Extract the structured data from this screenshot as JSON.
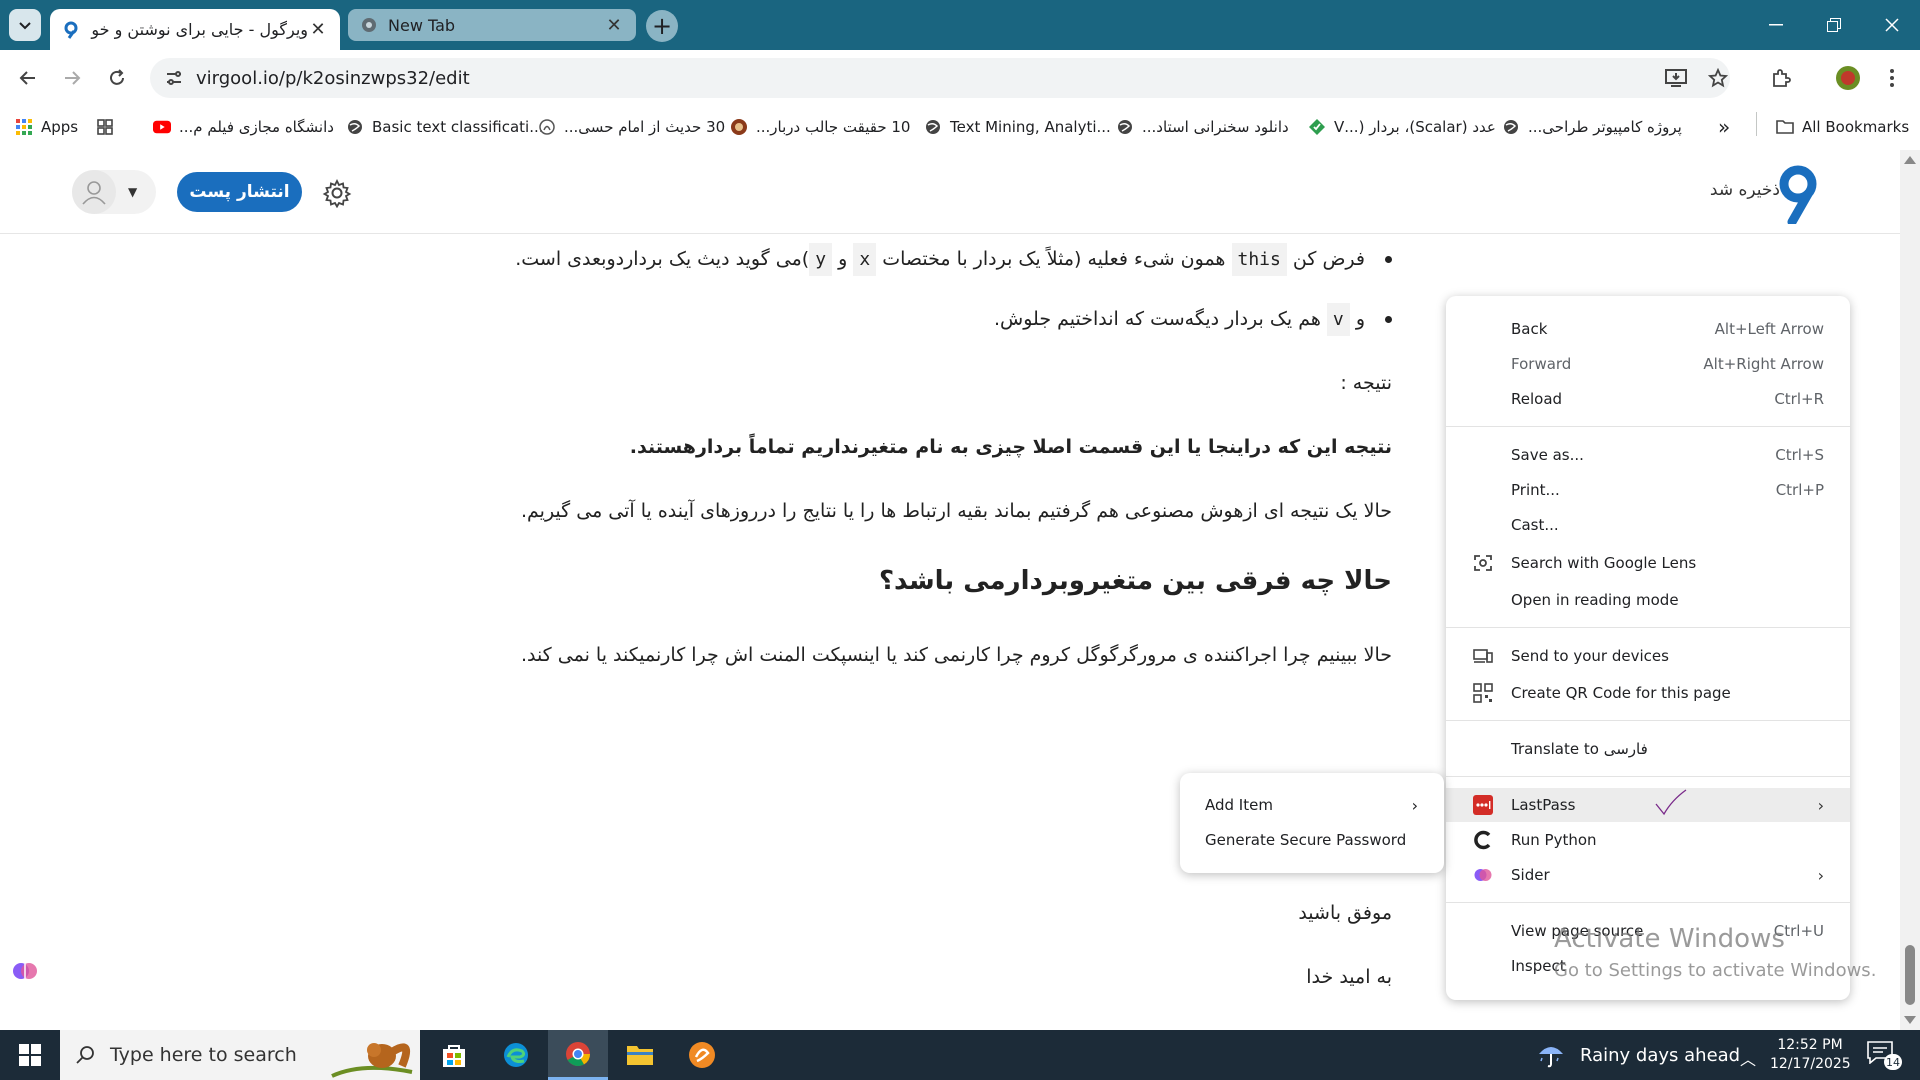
{
  "browser": {
    "tabs": [
      {
        "title": "ویرگول - جایی برای نوشتن و خواندن",
        "active": true
      },
      {
        "title": "New Tab",
        "active": false
      }
    ],
    "url": "virgool.io/p/k2osinzwps32/edit",
    "bookmarks": [
      {
        "label": "Apps",
        "icon": "apps-grid-icon"
      },
      {
        "label": "",
        "icon": "tab-groups-icon"
      },
      {
        "label": "دانشگاه مجازی فیلم م...",
        "icon": "youtube-icon"
      },
      {
        "label": "Basic text classificati...",
        "icon": "globe-icon"
      },
      {
        "label": "30 حدیث از امام حسی...",
        "icon": "site-icon"
      },
      {
        "label": "10 حقیقت جالب دربار...",
        "icon": "site-icon"
      },
      {
        "label": "Text Mining, Analyti...",
        "icon": "globe-icon"
      },
      {
        "label": "دانلود سخنرانی استاد...",
        "icon": "globe-icon"
      },
      {
        "label": "عدد (Scalar)، بردار (...V",
        "icon": "site-icon"
      },
      {
        "label": "پروژه کامپیوتر طراحی...",
        "icon": "globe-icon"
      }
    ],
    "more_bookmarks": "»",
    "all_bookmarks": "All Bookmarks"
  },
  "page": {
    "saved_status": "ذخیره شد",
    "publish_label": "انتشار پست",
    "article": {
      "bullet1_pre": "فرض کن",
      "bullet1_code1": "this",
      "bullet1_mid": "همون شیء فعلیه (مثلاً یک بردار با مختصات",
      "bullet1_code2": "x",
      "bullet1_and": "و",
      "bullet1_code3": "y",
      "bullet1_post": ")می گوید دیث یک برداردوبعدی است.",
      "bullet2_pre": "و",
      "bullet2_code": "v",
      "bullet2_post": "هم یک بردار دیگه‌ست که انداختیم جلوش.",
      "result_label": "نتیجه :",
      "result_bold": "نتیجه این که دراینجا یا این قسمت اصلا چیزی به نام متغیرنداریم تماماً بردارهستند.",
      "para1": "حالا یک نتیجه ای ازهوش مصنوعی هم گرفتیم بماند بقیه ارتباط ها را یا نتایج را درروزهای آینده یا آتی می گیریم.",
      "heading": "حالا چه فرقی بین متغیروبردارمی باشد؟",
      "para2": "حالا ببینیم چرا اجراکننده ی مرورگرگوگل کروم چرا کارنمی کند یا اینسپکت المنت اش چرا کارنمیکند یا نمی کند.",
      "closing1": "موفق باشید",
      "closing2": "به امید خدا"
    }
  },
  "context_menu": {
    "back": "Back",
    "back_sc": "Alt+Left Arrow",
    "forward": "Forward",
    "forward_sc": "Alt+Right Arrow",
    "reload": "Reload",
    "reload_sc": "Ctrl+R",
    "save_as": "Save as...",
    "save_as_sc": "Ctrl+S",
    "print": "Print...",
    "print_sc": "Ctrl+P",
    "cast": "Cast...",
    "lens": "Search with Google Lens",
    "reading": "Open in reading mode",
    "send": "Send to your devices",
    "qr": "Create QR Code for this page",
    "translate": "Translate to فارسی",
    "lastpass": "LastPass",
    "run_python": "Run Python",
    "sider": "Sider",
    "view_source": "View page source",
    "view_source_sc": "Ctrl+U",
    "inspect": "Inspect"
  },
  "submenu": {
    "add_item": "Add Item",
    "generate": "Generate Secure Password"
  },
  "watermark": {
    "line1": "Activate Windows",
    "line2": "Go to Settings to activate Windows."
  },
  "taskbar": {
    "search_placeholder": "Type here to search",
    "weather": "Rainy days ahead",
    "time": "12:52 PM",
    "date": "12/17/2025",
    "notifications": "14"
  },
  "colors": {
    "tabstrip": "#1a6580",
    "publish": "#1a6ebe",
    "lastpass": "#d32d27",
    "taskbar": "#1c2b38"
  }
}
